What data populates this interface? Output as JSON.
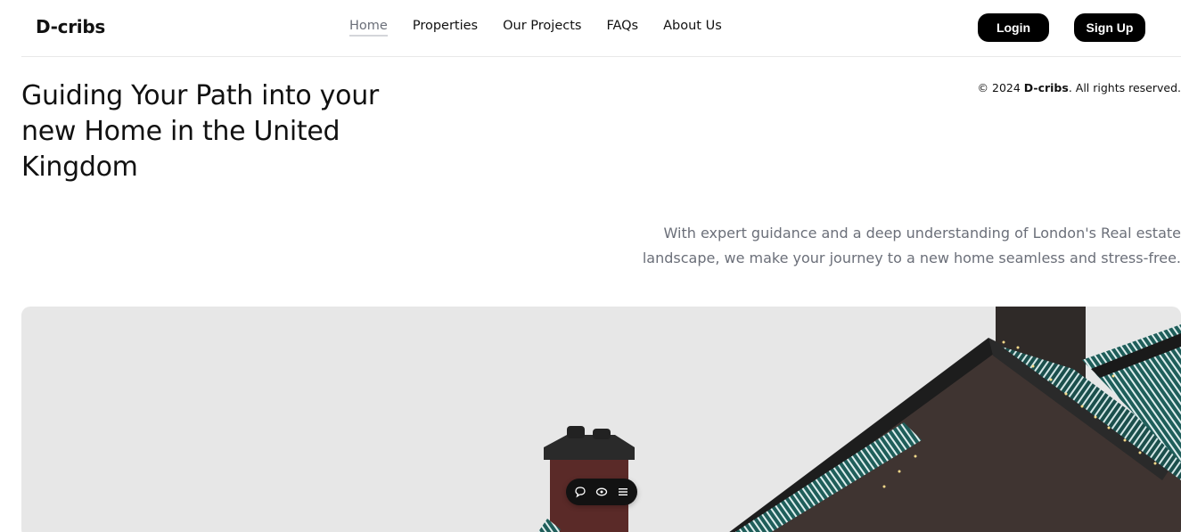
{
  "header": {
    "logo": "D-cribs",
    "nav": [
      {
        "label": "Home",
        "active": true
      },
      {
        "label": "Properties",
        "active": false
      },
      {
        "label": "Our Projects",
        "active": false
      },
      {
        "label": "FAQs",
        "active": false
      },
      {
        "label": "About Us",
        "active": false
      }
    ],
    "login_label": "Login",
    "signup_label": "Sign Up"
  },
  "hero": {
    "title": "Guiding Your Path into your new Home in the United Kingdom",
    "copyright_prefix": "© 2024 ",
    "copyright_brand": "D-cribs",
    "copyright_suffix": ". All rights reserved.",
    "description": "With expert guidance and a deep understanding of London's Real estate landscape, we make your journey to a new home seamless and stress-free."
  },
  "image": {
    "subject": "house rooftops with chimneys",
    "icons": [
      "chat-icon",
      "eye-icon",
      "menu-icon"
    ]
  },
  "colors": {
    "accent": "#000000",
    "muted_text": "#6b6f79",
    "roof_teal": "#1f5e5a",
    "wall_brown": "#3f3431",
    "chimney_red": "#5a2a28"
  }
}
